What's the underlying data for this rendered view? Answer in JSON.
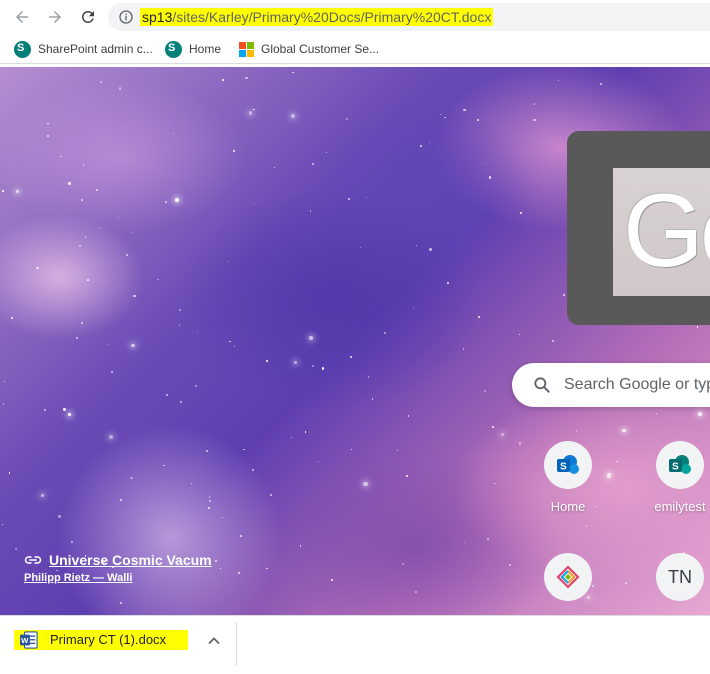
{
  "browser": {
    "url": {
      "host": "sp13",
      "path": "/sites/Karley/Primary%20Docs/Primary%20CT.docx"
    }
  },
  "bookmarks": [
    {
      "label": "SharePoint admin c...",
      "icon": "sharepoint-icon"
    },
    {
      "label": "Home",
      "icon": "sharepoint-icon"
    },
    {
      "label": "Global Customer Se...",
      "icon": "microsoft-icon"
    }
  ],
  "ntp": {
    "search_placeholder": "Search Google or typ",
    "doodle_text": "Go",
    "shortcuts": [
      {
        "label": "Home",
        "icon": "sharepoint-icon"
      },
      {
        "label": "emilytest",
        "icon": "sharepoint-icon"
      },
      {
        "label": "",
        "icon": "powerapps-icon"
      },
      {
        "label": "",
        "initials": "TN"
      }
    ],
    "attribution": {
      "title": "Universe Cosmic Vacum",
      "author": "Philipp Rietz — Walli"
    }
  },
  "downloads": [
    {
      "filename": "Primary CT (1).docx",
      "icon": "word-icon"
    }
  ],
  "colors": {
    "highlight": "#ffff00",
    "sharepoint": "#037f7a"
  }
}
